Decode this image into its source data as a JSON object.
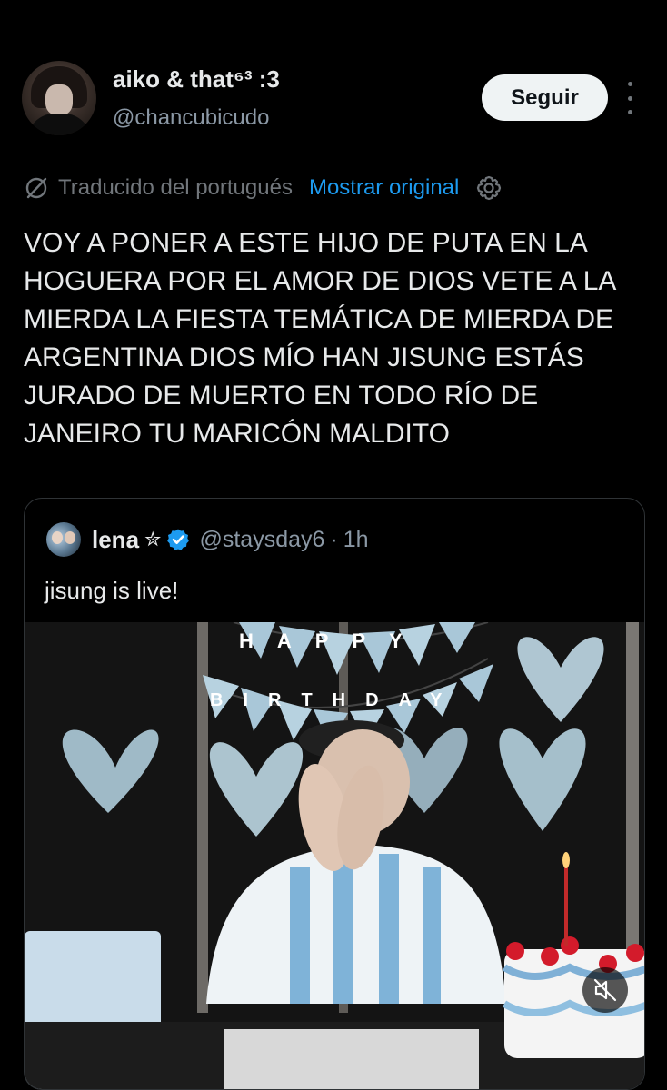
{
  "author": {
    "display_name": "aiko & that⁶³ :3",
    "handle": "@chancubicudo"
  },
  "actions": {
    "follow_label": "Seguir"
  },
  "translation": {
    "label": "Traducido del portugués",
    "show_original": "Mostrar original"
  },
  "tweet": {
    "text": "VOY A PONER A ESTE HIJO DE PUTA EN LA HOGUERA POR EL AMOR DE DIOS VETE A LA MIERDA LA FIESTA TEMÁTICA DE MIERDA DE ARGENTINA DIOS MÍO HAN JISUNG ESTÁS JURADO DE MUERTO EN TODO RÍO DE JANEIRO TU MARICÓN MALDITO"
  },
  "quoted": {
    "name": "lena",
    "name_symbol": "✮",
    "handle": "@staysday6",
    "separator": "·",
    "time": "1h",
    "text": "jisung is live!",
    "banner_top": "HAPPY",
    "banner_bottom": "BIRTHDAY"
  },
  "icons": {
    "translate": "translate-icon",
    "settings": "gear-icon",
    "verified": "verified-badge-icon",
    "more": "more-vertical-icon",
    "mute": "muted-speaker-icon"
  },
  "colors": {
    "background": "#000000",
    "link": "#1d9bf0",
    "muted_text": "#71767b",
    "follow_button_bg": "#eff3f4",
    "verified": "#1d9bf0"
  }
}
